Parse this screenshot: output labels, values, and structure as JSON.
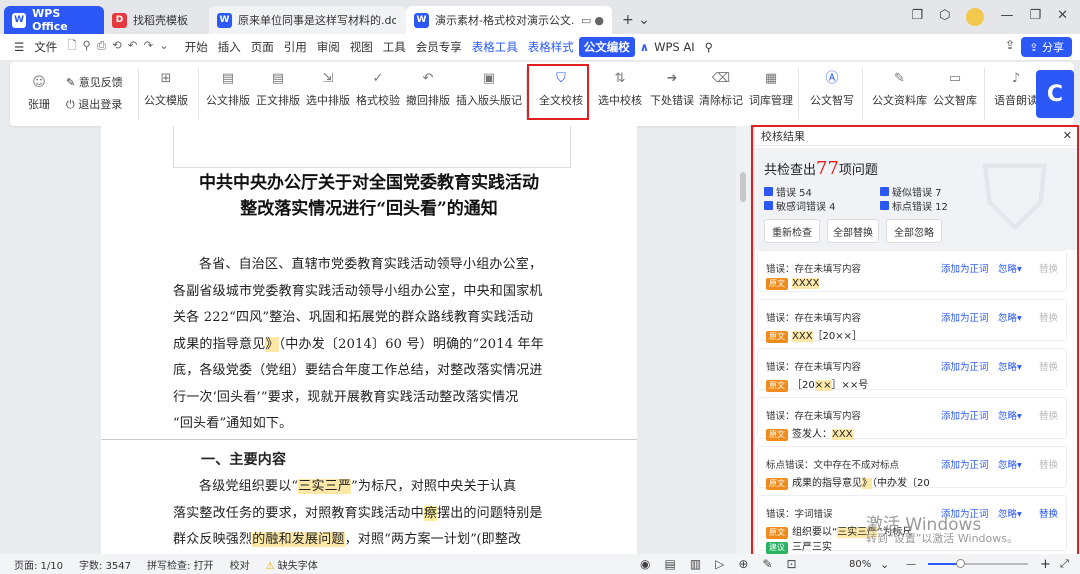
{
  "tabs": [
    {
      "label": "WPS Office",
      "icon": "W"
    },
    {
      "label": "找稻壳模板",
      "icon": "D"
    },
    {
      "label": "原来单位同事是这样写材料的.do",
      "icon": "W"
    },
    {
      "label": "演示素材-格式校对演示公文.",
      "icon": "W"
    }
  ],
  "menu": {
    "file": "文件",
    "items": [
      "开始",
      "插入",
      "页面",
      "引用",
      "审阅",
      "视图",
      "工具",
      "会员专享"
    ],
    "table_tools": "表格工具",
    "table_style": "表格样式",
    "active": "公文编校",
    "wps_ai": "WPS AI",
    "share": "分享"
  },
  "ribbon": {
    "user": "张珊",
    "feedback": "意见反馈",
    "logout": "退出登录",
    "buttons": [
      "公文模版",
      "公文排版",
      "正文排版",
      "选中排版",
      "格式校验",
      "撤回排版",
      "插入版头版记",
      "全文校核",
      "选中校核",
      "下处错误",
      "清除标记",
      "词库管理",
      "公文智写",
      "公文资料库",
      "公文智库",
      "语音朗读"
    ]
  },
  "doc": {
    "title_line1": "中共中央办公厅关于对全国党委教育实践活动",
    "title_line2": "整改落实情况进行“回头看”的通知",
    "p1": [
      "各省、自治区、直辖市党委教育实践活动领导小组办公室，",
      "各副省级城市党委教育实践活动领导小组办公室，中央和国家机",
      "关各 222“四风”整治、巩固和拓展党的群众路线教育实践活动",
      "成果的指导意见",
      "（中办发〔2014〕60 号）明确的“2014 年年",
      "底，各级党委（党组）要结合年度工作总结，对整改落实情况进",
      "行一次‘回头看’”要求，现就开展教育实践活动整改落实情况",
      "“回头看”通知如下。"
    ],
    "h1": "一、主要内容",
    "p2": [
      "各级党组织要以“",
      "三实三严",
      "”为标尺，对照中央关于认真",
      "落实整改任务的要求，对照教育实践活动中",
      "瘵",
      "摆出的问题特别是",
      "群众反映强烈",
      "的融和发展问题",
      "，对照“两方案一计划”",
      "(即整改"
    ]
  },
  "panel": {
    "title": "校核结果",
    "summary_prefix": "共检查出",
    "count": "77",
    "summary_suffix": "项问题",
    "checks": [
      "错误 54",
      "疑似错误 7",
      "敏感词错误 4",
      "标点错误 12"
    ],
    "buttons": [
      "重新检查",
      "全部替换",
      "全部忽略"
    ],
    "action_add": "添加为正词",
    "action_ignore": "忽略▾",
    "action_replace": "替换",
    "tag_orig": "原文",
    "tag_sugg": "建议",
    "cards": [
      {
        "type": "错误：存在未填写内容",
        "pre": "",
        "hl": "XXXX",
        "post": ""
      },
      {
        "type": "错误：存在未填写内容",
        "pre": "",
        "hl": "XXX",
        "post": "［20××］"
      },
      {
        "type": "错误：存在未填写内容",
        "pre": "［20",
        "hl": "××",
        "post": "］××号"
      },
      {
        "type": "错误：存在未填写内容",
        "pre": "签发人：",
        "hl": "XXX",
        "post": ""
      },
      {
        "type": "标点错误：文中存在不成对标点",
        "pre": "成果的指导意见",
        "hl": "》",
        "post": "（中办发〔20"
      },
      {
        "type": "错误：字词错误",
        "pre": "组织要以“",
        "hl": "三实三严",
        "post": "”为标尺",
        "sugg": "三严三实"
      }
    ]
  },
  "status": {
    "page": "页面: 1/10",
    "words": "字数: 3547",
    "spell": "拼写检查: 打开",
    "proof": "校对",
    "missing_font": "缺失字体",
    "zoom": "80%"
  },
  "watermark": {
    "line1": "激活 Windows",
    "line2": "转到“设置”以激活 Windows。"
  }
}
